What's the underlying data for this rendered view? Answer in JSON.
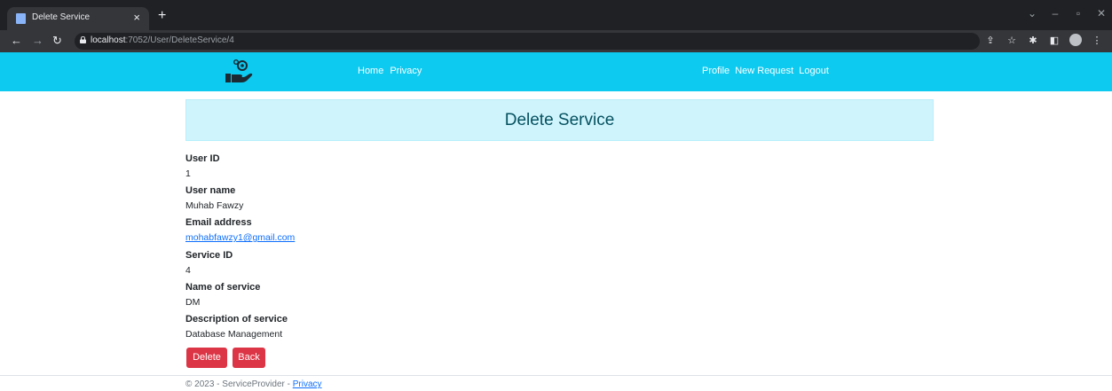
{
  "browser": {
    "tab_title": "Delete Service",
    "tab_close": "×",
    "new_tab": "+",
    "url_host": "localhost",
    "url_path": ":7052/User/DeleteService/4",
    "controls": {
      "minimize": "–",
      "restore": "▫",
      "close": "✕",
      "dropdown": "⌄"
    }
  },
  "navbar": {
    "brand_icon": "hand-gear-icon",
    "left_links": [
      "Home",
      "Privacy"
    ],
    "right_links": [
      "Profile",
      "New Request",
      "Logout"
    ],
    "background": "#0dcaf0"
  },
  "page": {
    "title": "Delete Service",
    "fields": [
      {
        "label": "User ID",
        "value": "1"
      },
      {
        "label": "User name",
        "value": "Muhab Fawzy"
      },
      {
        "label": "Email address",
        "value": "mohabfawzy1@gmail.com"
      },
      {
        "label": "Service ID",
        "value": "4"
      },
      {
        "label": "Name of service",
        "value": "DM"
      },
      {
        "label": "Description of service",
        "value": "Database Management"
      }
    ],
    "buttons": {
      "delete": "Delete",
      "back": "Back"
    }
  },
  "footer": {
    "text": "© 2023 - ServiceProvider - ",
    "link": "Privacy"
  },
  "colors": {
    "accent": "#0dcaf0",
    "danger": "#dc3545",
    "heading_bg": "#cff4fc",
    "link": "#0d6efd"
  }
}
